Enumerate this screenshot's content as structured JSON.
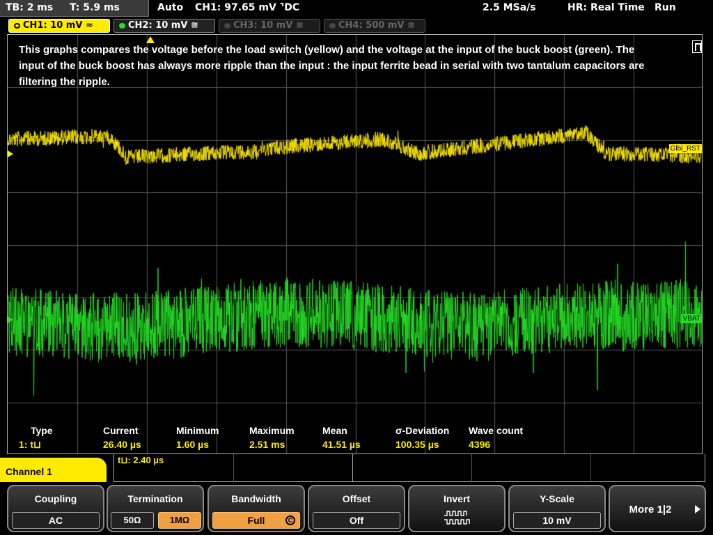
{
  "topbar": {
    "tb": "TB: 2 ms",
    "t": "T: 5.9 ms",
    "mode": "Auto",
    "trigger": "CH1: 97.65 mV ⌝DC",
    "rate": "2.5 MSa/s",
    "hr": "HR: Real Time",
    "state": "Run"
  },
  "channels": [
    {
      "label": "CH1: 10 mV ≈",
      "active": true,
      "color": "#ffeb00"
    },
    {
      "label": "CH2: 10 mV ≅",
      "active": true,
      "color": "#24e024"
    },
    {
      "label": "CH3: 10 mV ≅",
      "active": false,
      "color": "#666666"
    },
    {
      "label": "CH4: 500 mV ≅",
      "active": false,
      "color": "#666666"
    }
  ],
  "note": "This graphs compares the voltage before the load switch (yellow) and the voltage at the input of the buck boost (green). The input of the buck boost has always more ripple than the input : the input ferrite bead in serial with two tantalum capacitors are filtering the ripple.",
  "wave_labels": {
    "ch1": "Glbl_RST",
    "ch2": "VBAT"
  },
  "colors": {
    "ch1": "#ffeb00",
    "ch2": "#24e024",
    "grid": "#5a5a5a"
  },
  "measurements": {
    "headers": [
      "Type",
      "Current",
      "Minimum",
      "Maximum",
      "Mean",
      "σ-Deviation",
      "Wave count"
    ],
    "values": [
      "1: t⊔",
      "26.40 µs",
      "1.60 µs",
      "2.51 ms",
      "41.51 µs",
      "100.35 µs",
      "4396"
    ]
  },
  "trigger_strip": {
    "text": "t⊔: 2.40 µs"
  },
  "menu": {
    "channel": "Channel 1",
    "coupling": {
      "title": "Coupling",
      "value": "AC"
    },
    "termination": {
      "title": "Termination",
      "opt1": "50Ω",
      "opt2": "1MΩ"
    },
    "bandwidth": {
      "title": "Bandwidth",
      "value": "Full",
      "icon": "C"
    },
    "offset": {
      "title": "Offset",
      "value": "Off"
    },
    "invert": {
      "title": "Invert"
    },
    "yscale": {
      "title": "Y-Scale",
      "value": "10 mV"
    },
    "more": {
      "title": "More 1|2"
    }
  }
}
